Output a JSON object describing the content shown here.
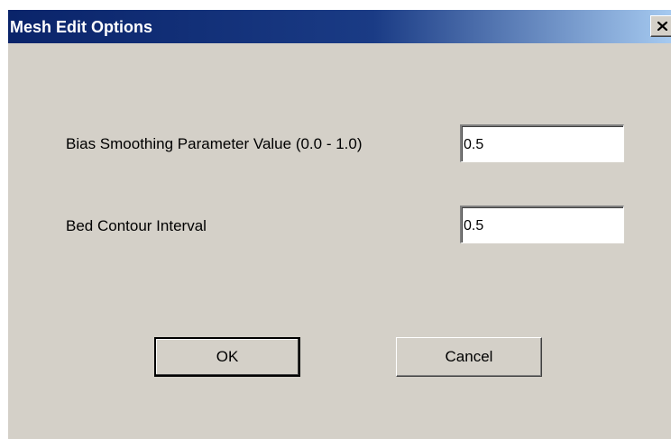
{
  "window": {
    "title": "Mesh Edit Options",
    "close_icon": "close-icon"
  },
  "fields": {
    "bias_smoothing": {
      "label": "Bias Smoothing Parameter Value  (0.0 - 1.0)",
      "value": "0.5"
    },
    "bed_contour": {
      "label": "Bed Contour Interval",
      "value": "0.5"
    }
  },
  "buttons": {
    "ok_label": "OK",
    "cancel_label": "Cancel"
  },
  "colors": {
    "title_bar_start": "#0a246a",
    "title_bar_end": "#a6caf0",
    "dialog_face": "#d4d0c8"
  }
}
